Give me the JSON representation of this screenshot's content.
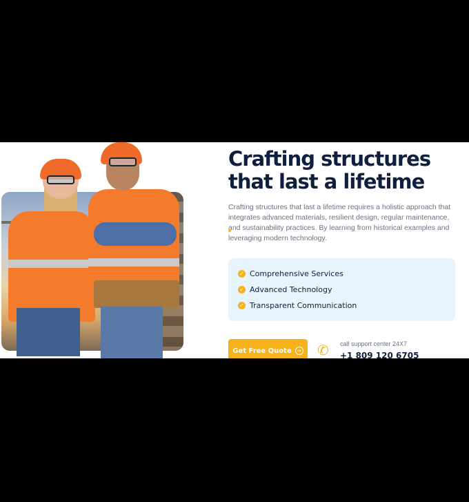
{
  "hero": {
    "title_line1": "Crafting structures",
    "title_line2": "that last a lifetime",
    "description": "Crafting structures that last a lifetime requires a holistic approach that integrates advanced materials, resilient design, regular maintenance, and sustainability practices. By learning from historical examples and leveraging modern technology."
  },
  "features": [
    {
      "label": "Comprehensive Services",
      "icon": "check-circle-icon"
    },
    {
      "label": "Advanced Technology",
      "icon": "check-circle-icon"
    },
    {
      "label": "Transparent Communication",
      "icon": "check-circle-icon"
    }
  ],
  "cta": {
    "label": "Get Free Quote",
    "icon": "arrow-right-circle-icon"
  },
  "support": {
    "label": "call support center 24X7",
    "number": "+1 809 120 6705",
    "icon": "phone-icon"
  },
  "colors": {
    "accent": "#f6b21b",
    "heading": "#0f1f3d",
    "feature_bg": "#e8f4fb"
  },
  "image": {
    "subject": "two-construction-workers-photo"
  }
}
